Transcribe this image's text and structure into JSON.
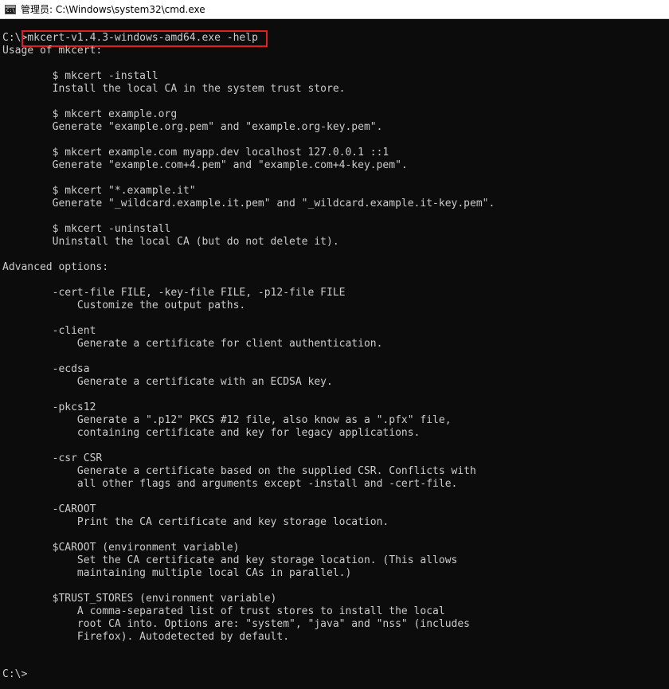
{
  "window": {
    "title": "管理员: C:\\Windows\\system32\\cmd.exe",
    "icon": "cmd-icon",
    "icon_glyph": "C:\\"
  },
  "colors": {
    "background": "#0c0c0c",
    "text": "#cccccc",
    "highlight_border": "#e02020",
    "titlebar": "#ffffff"
  },
  "console": {
    "command_line": "C:\\>mkcert-v1.4.3-windows-amd64.exe -help",
    "lines": [
      "Usage of mkcert:",
      "",
      "        $ mkcert -install",
      "        Install the local CA in the system trust store.",
      "",
      "        $ mkcert example.org",
      "        Generate \"example.org.pem\" and \"example.org-key.pem\".",
      "",
      "        $ mkcert example.com myapp.dev localhost 127.0.0.1 ::1",
      "        Generate \"example.com+4.pem\" and \"example.com+4-key.pem\".",
      "",
      "        $ mkcert \"*.example.it\"",
      "        Generate \"_wildcard.example.it.pem\" and \"_wildcard.example.it-key.pem\".",
      "",
      "        $ mkcert -uninstall",
      "        Uninstall the local CA (but do not delete it).",
      "",
      "Advanced options:",
      "",
      "        -cert-file FILE, -key-file FILE, -p12-file FILE",
      "            Customize the output paths.",
      "",
      "        -client",
      "            Generate a certificate for client authentication.",
      "",
      "        -ecdsa",
      "            Generate a certificate with an ECDSA key.",
      "",
      "        -pkcs12",
      "            Generate a \".p12\" PKCS #12 file, also know as a \".pfx\" file,",
      "            containing certificate and key for legacy applications.",
      "",
      "        -csr CSR",
      "            Generate a certificate based on the supplied CSR. Conflicts with",
      "            all other flags and arguments except -install and -cert-file.",
      "",
      "        -CAROOT",
      "            Print the CA certificate and key storage location.",
      "",
      "        $CAROOT (environment variable)",
      "            Set the CA certificate and key storage location. (This allows",
      "            maintaining multiple local CAs in parallel.)",
      "",
      "        $TRUST_STORES (environment variable)",
      "            A comma-separated list of trust stores to install the local",
      "            root CA into. Options are: \"system\", \"java\" and \"nss\" (includes",
      "            Firefox). Autodetected by default.",
      ""
    ],
    "prompt": "C:\\>"
  }
}
